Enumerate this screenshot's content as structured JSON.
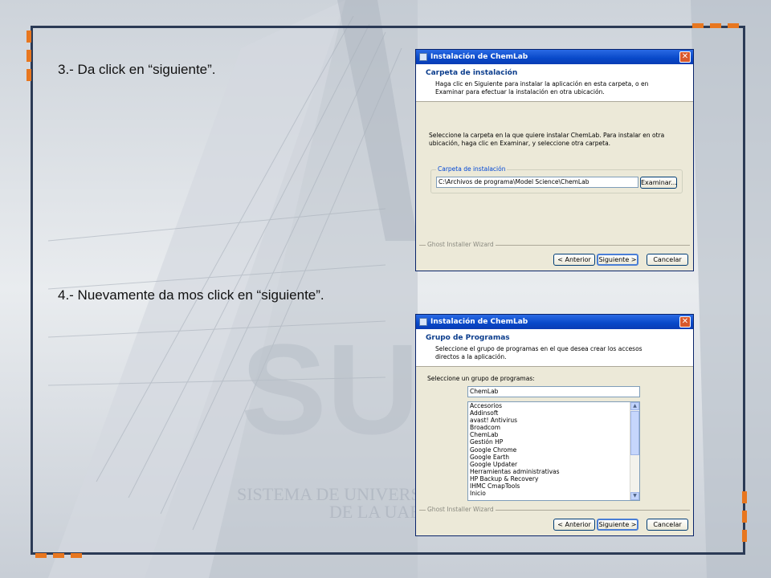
{
  "slide": {
    "step3": "3.-  Da click en “siguiente”.",
    "step4": "4.- Nuevamente da mos click en “siguiente”.",
    "watermark_line1": "SISTEMA DE UNIVERSI",
    "watermark_line2": "DE LA UAE",
    "accent_color": "#e8771f",
    "frame_color": "#2b3a55"
  },
  "dialog1": {
    "title": "Instalación de ChemLab",
    "header_title": "Carpeta de instalación",
    "header_desc": "Haga clic en Siguiente para instalar la aplicación en esta carpeta, o en Examinar para efectuar la instalación en otra ubicación.",
    "body_text": "Seleccione la carpeta en la que quiere instalar ChemLab. Para instalar en otra ubicación, haga clic en Examinar, y seleccione otra carpeta.",
    "group_label": "Carpeta de instalación",
    "path_value": "C:\\Archivos de programa\\Model Science\\ChemLab",
    "browse_label": "Examinar...",
    "footer_label": "Ghost Installer Wizard",
    "back_label": "< Anterior",
    "next_label": "Siguiente >",
    "cancel_label": "Cancelar"
  },
  "dialog2": {
    "title": "Instalación de ChemLab",
    "header_title": "Grupo de Programas",
    "header_desc": "Seleccione el grupo de programas en el que desea crear los accesos directos a la aplicación.",
    "body_text": "Seleccione un grupo de programas:",
    "group_value": "ChemLab",
    "list_items": [
      "Accesorios",
      "Addinsoft",
      "avast! Antivirus",
      "Broadcom",
      "ChemLab",
      "Gestión HP",
      "Google Chrome",
      "Google Earth",
      "Google Updater",
      "Herramientas administrativas",
      "HP Backup & Recovery",
      "IHMC CmapTools",
      "Inicio"
    ],
    "footer_label": "Ghost Installer Wizard",
    "back_label": "< Anterior",
    "next_label": "Siguiente >",
    "cancel_label": "Cancelar"
  }
}
